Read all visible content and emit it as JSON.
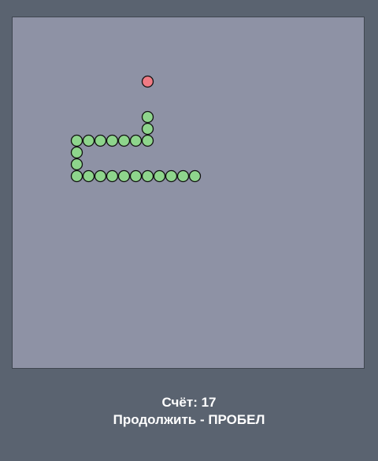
{
  "game": {
    "grid": {
      "cols": 30,
      "rows": 30
    },
    "colors": {
      "board": "#8e92a5",
      "snake": "#8ed58c",
      "food": "#f07b84",
      "outline": "#111111"
    },
    "snake": [
      [
        6,
        13
      ],
      [
        7,
        13
      ],
      [
        8,
        13
      ],
      [
        9,
        13
      ],
      [
        10,
        13
      ],
      [
        11,
        13
      ],
      [
        12,
        13
      ],
      [
        13,
        13
      ],
      [
        14,
        13
      ],
      [
        15,
        13
      ],
      [
        5,
        13
      ],
      [
        5,
        12
      ],
      [
        5,
        11
      ],
      [
        5,
        10
      ],
      [
        6,
        10
      ],
      [
        7,
        10
      ],
      [
        8,
        10
      ],
      [
        9,
        10
      ],
      [
        10,
        10
      ],
      [
        11,
        10
      ],
      [
        11,
        9
      ],
      [
        11,
        8
      ]
    ],
    "food": [
      11,
      5
    ]
  },
  "hud": {
    "score_text": "Счёт: 17",
    "hint_text": "Продолжить - ПРОБЕЛ"
  }
}
